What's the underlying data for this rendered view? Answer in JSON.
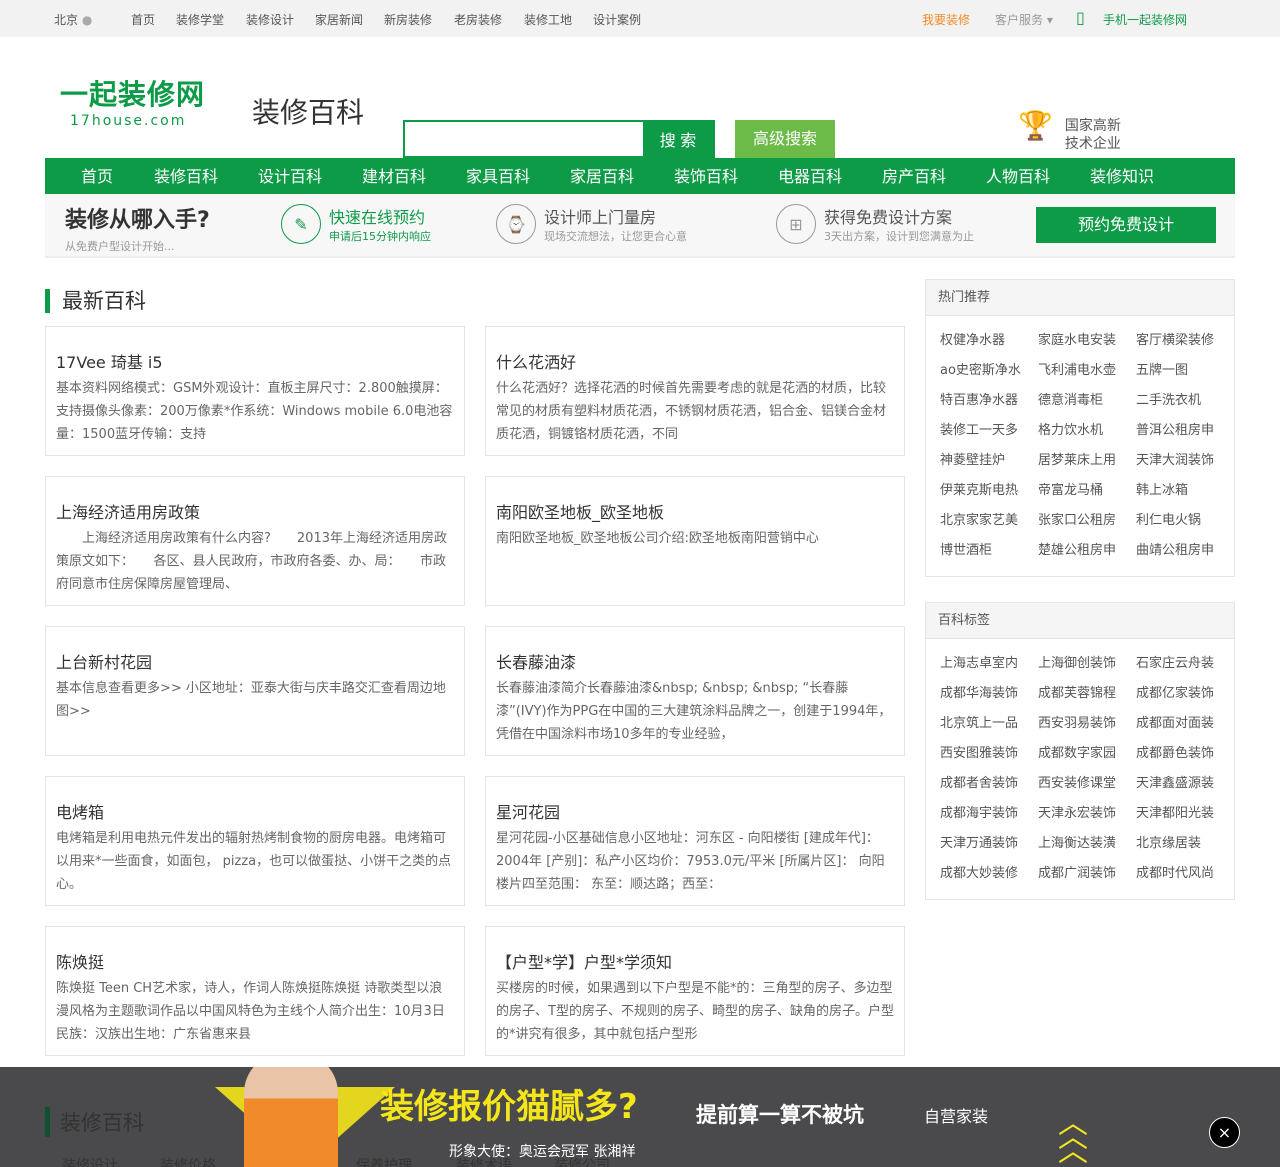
{
  "topbar": {
    "city": "北京",
    "links": [
      "首页",
      "装修学堂",
      "装修设计",
      "家居新闻",
      "新房装修",
      "老房装修",
      "装修工地",
      "设计案例"
    ],
    "want": "我要装修",
    "service": "客户服务",
    "mobile": "手机一起装修网"
  },
  "header": {
    "logo_cn": "一起装修网",
    "logo_en": "17house.com",
    "page_title": "装修百科",
    "search_placeholder": "",
    "search_button": "搜 索",
    "advanced_search": "高级搜索",
    "cert_line1": "国家高新",
    "cert_line2": "技术企业"
  },
  "nav": [
    "首页",
    "装修百科",
    "设计百科",
    "建材百科",
    "家具百科",
    "家居百科",
    "装饰百科",
    "电器百科",
    "房产百科",
    "人物百科",
    "装修知识"
  ],
  "steps": {
    "question": "装修从哪入手?",
    "question_sub": "从免费户型设计开始...",
    "items": [
      {
        "title": "快速在线预约",
        "sub": "申请后15分钟内响应"
      },
      {
        "title": "设计师上门量房",
        "sub": "现场交流想法，让您更合心意"
      },
      {
        "title": "获得免费设计方案",
        "sub": "3天出方案，设计到您满意为止"
      }
    ],
    "cta": "预约免费设计"
  },
  "latest": {
    "title": "最新百科",
    "items": [
      {
        "title": "17Vee 琦基 i5",
        "text": "基本资料网络模式：GSM外观设计：直板主屏尺寸：2.800触摸屏：支持摄像头像素：200万像素*作系统：Windows mobile 6.0电池容量：1500蓝牙传输：支持"
      },
      {
        "title": "什么花洒好",
        "text": "什么花洒好？选择花洒的时候首先需要考虑的就是花洒的材质，比较常见的材质有塑料材质花洒，不锈钢材质花洒，铝合金、铝镁合金材质花洒，铜镀铬材质花洒，不同"
      },
      {
        "title": "上海经济适用房政策",
        "text": "　　上海经济适用房政策有什么内容?　　2013年上海经济适用房政策原文如下：　　各区、县人民政府，市政府各委、办、局：　　市政府同意市住房保障房屋管理局、"
      },
      {
        "title": "南阳欧圣地板_欧圣地板",
        "text": "南阳欧圣地板_欧圣地板公司介绍:欧圣地板南阳营销中心"
      },
      {
        "title": "上台新村花园",
        "text": "基本信息查看更多>> 小区地址：亚泰大街与庆丰路交汇查看周边地图>>"
      },
      {
        "title": "长春藤油漆",
        "text": "长春藤油漆简介长春藤油漆&nbsp; &nbsp; &nbsp; “长春藤漆”(IVY)作为PPG在中国的三大建筑涂料品牌之一，创建于1994年，凭借在中国涂料市场10多年的专业经验，"
      },
      {
        "title": "电烤箱",
        "text": "电烤箱是利用电热元件发出的辐射热烤制食物的厨房电器。电烤箱可以用来*一些面食，如面包， pizza，也可以做蛋挞、小饼干之类的点心。"
      },
      {
        "title": "星河花园",
        "text": "星河花园-小区基础信息小区地址：河东区 - 向阳楼街 [建成年代]：2004年 [产别]：私产小区均价：7953.0元/平米 [所属片区]： 向阳楼片四至范围： 东至：顺达路；西至："
      },
      {
        "title": "陈焕挺",
        "text": "陈焕挺 Teen CH艺术家，诗人，作词人陈焕挺陈焕挺 诗歌类型以浪漫风格为主题歌词作品以中国风特色为主线个人简介出生：10月3日民族：汉族出生地：广东省惠来县"
      },
      {
        "title": "【户型*学】户型*学须知",
        "text": "买楼房的时候，如果遇到以下户型是不能*的：三角型的房子、多边型的房子、T型的房子、不规则的房子、畸型的房子、缺角的房子。户型的*讲究有很多，其中就包括户型形"
      }
    ]
  },
  "hot": {
    "title": "热门推荐",
    "items": [
      "权健净水器",
      "家庭水电安装",
      "客厅横梁装修",
      "ao史密斯净水",
      "飞利浦电水壶",
      "五牌一图",
      "特百惠净水器",
      "德意消毒柜",
      "二手洗衣机",
      "装修工一天多",
      "格力饮水机",
      "普洱公租房申",
      "神菱壁挂炉",
      "居梦莱床上用",
      "天津大润装饰",
      "伊莱克斯电热",
      "帝富龙马桶",
      "韩上冰箱",
      "北京家家艺美",
      "张家口公租房",
      "利仁电火锅",
      "博世酒柜",
      "楚雄公租房申",
      "曲靖公租房申"
    ]
  },
  "tags": {
    "title": "百科标签",
    "items": [
      "上海志卓室内",
      "上海御创装饰",
      "石家庄云舟装",
      "成都华海装饰",
      "成都芙蓉锦程",
      "成都亿家装饰",
      "北京筑上一品",
      "西安羽易装饰",
      "成都面对面装",
      "西安图雅装饰",
      "成都数字家园",
      "成都爵色装饰",
      "成都者舍装饰",
      "西安装修课堂",
      "天津鑫盛源装",
      "成都海宇装饰",
      "天津永宏装饰",
      "天津都阳光装",
      "天津万通装饰",
      "上海衡达装潢",
      "北京缘居装",
      "成都大妙装修",
      "成都广润装饰",
      "成都时代风尚"
    ]
  },
  "bottom": {
    "title": "装修百科",
    "subs": [
      "装修设计",
      "装修价格",
      "保养护理",
      "装修术语",
      "装修公司"
    ]
  },
  "ad": {
    "headline": "装修报价猫腻多?",
    "slogan": "提前算一算不被坑",
    "brand": "自营家装",
    "ambassador": "形象大使：奥运会冠军 张湘祥",
    "close": "×"
  },
  "colors": {
    "brand_green": "#0e9b48",
    "light_green": "#6cbb48",
    "orange": "#f08a2a"
  }
}
